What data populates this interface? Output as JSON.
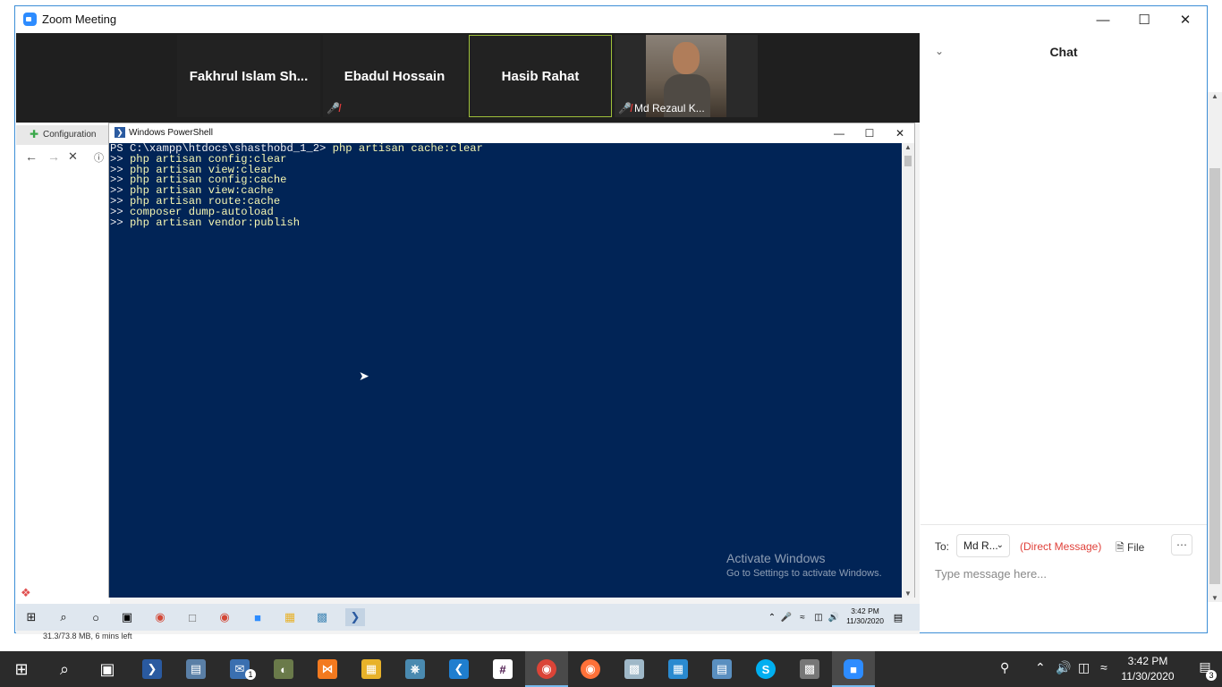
{
  "zoom": {
    "title": "Zoom Meeting",
    "participants": [
      {
        "name": "Fakhrul  Islam  Sh...",
        "muted": false
      },
      {
        "name": "Ebadul Hossain",
        "muted": true
      },
      {
        "name": "Hasib Rahat",
        "muted": false
      },
      {
        "name": "Md Rezaul K...",
        "muted": true
      }
    ]
  },
  "browser": {
    "tab_label": "Configuration"
  },
  "powershell": {
    "title": "Windows PowerShell",
    "prompt": "PS C:\\xampp\\htdocs\\shasthobd_1_2> ",
    "first_command": "php artisan cache:clear",
    "continuation_prefix": ">> ",
    "continued_commands": [
      "php artisan config:clear",
      "php artisan view:clear",
      "php artisan config:cache",
      "php artisan view:cache",
      "php artisan route:cache",
      "composer dump-autoload",
      "php artisan vendor:publish"
    ],
    "watermark_title": "Activate Windows",
    "watermark_subtitle": "Go to Settings to activate Windows."
  },
  "inner_taskbar": {
    "time": "3:42 PM",
    "date": "11/30/2020"
  },
  "chat": {
    "title": "Chat",
    "to_label": "To:",
    "recipient": "Md R...",
    "direct_message": "(Direct Message)",
    "file_label": "File",
    "input_placeholder": "Type message here..."
  },
  "background": {
    "download_status": "31.3/73.8 MB, 6 mins left"
  },
  "taskbar": {
    "time": "3:42 PM",
    "date": "11/30/2020",
    "notification_count": "3",
    "mail_badge": "1"
  }
}
